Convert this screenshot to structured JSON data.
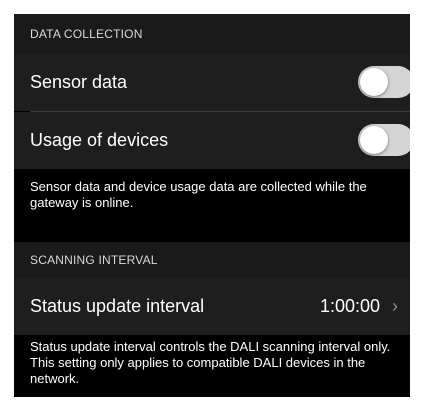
{
  "data_collection": {
    "header": "DATA COLLECTION",
    "rows": [
      {
        "label": "Sensor data",
        "enabled": false
      },
      {
        "label": "Usage of devices",
        "enabled": false
      }
    ],
    "footer": "Sensor data and device usage data are collected while the gateway is online."
  },
  "scanning_interval": {
    "header": "SCANNING INTERVAL",
    "row": {
      "label": "Status update interval",
      "value": "1:00:00",
      "chevron": "›"
    },
    "footer": "Status update interval controls the DALI scanning interval only. This setting only applies to compatible DALI devices in the network."
  },
  "icons": {
    "chevron": "chevron-right-icon"
  },
  "colors": {
    "background": "#000000",
    "section_header_bg": "#1a1a1a",
    "row_bg": "#1e1e1e",
    "toggle_off": "#d4d4d4"
  }
}
